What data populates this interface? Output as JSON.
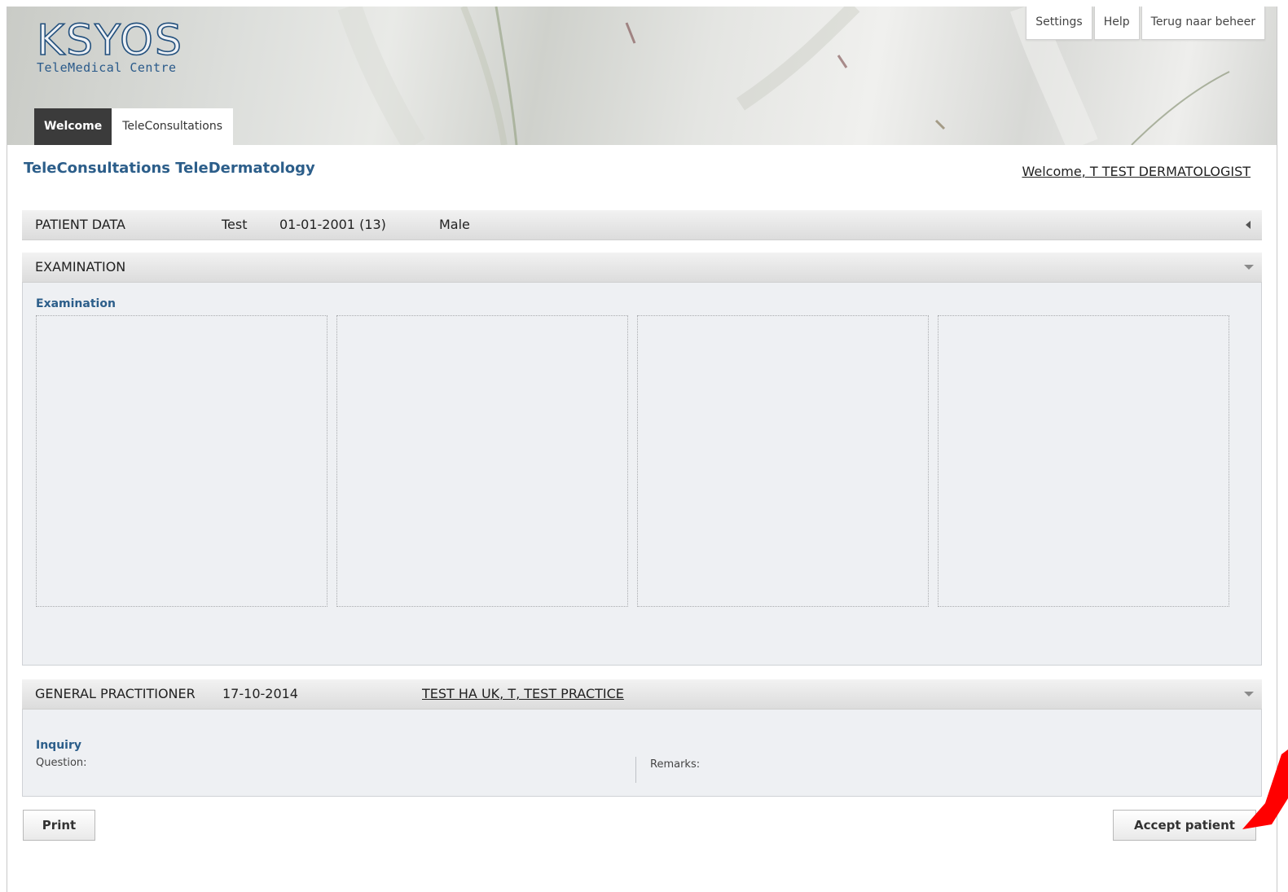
{
  "header": {
    "logo_main": "KSYOS",
    "logo_sub": "TeleMedical Centre",
    "top_links": [
      "Settings",
      "Help",
      "Terug naar beheer"
    ],
    "tabs": [
      {
        "label": "Welcome",
        "active": false
      },
      {
        "label": "TeleConsultations",
        "active": true
      }
    ]
  },
  "page": {
    "title": "TeleConsultations TeleDermatology",
    "welcome": "Welcome, T TEST DERMATOLOGIST"
  },
  "patient": {
    "bar_title": "PATIENT DATA",
    "name": "Test",
    "dob": "01-01-2001 (13)",
    "sex": "Male"
  },
  "examination": {
    "bar_title": "EXAMINATION",
    "section_label": "Examination",
    "image_slots": 4
  },
  "gp": {
    "bar_title": "GENERAL PRACTITIONER",
    "date": "17-10-2014",
    "practitioner": "TEST HA UK, T, TEST PRACTICE",
    "section_label": "Inquiry",
    "question_label": "Question:",
    "remarks_label": "Remarks:"
  },
  "actions": {
    "print_label": "Print",
    "accept_label": "Accept patient"
  },
  "colors": {
    "accent_blue": "#2c5e8a",
    "annotation_red": "#ff0000"
  }
}
